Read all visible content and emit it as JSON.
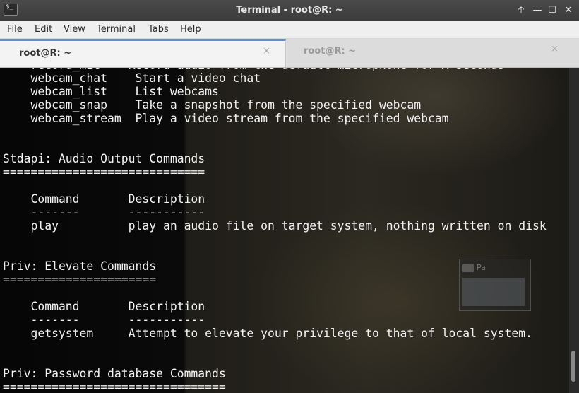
{
  "window": {
    "title": "Terminal - root@R: ~",
    "controls": {
      "up": "🡡",
      "minimize": "—",
      "maximize": "☐",
      "close": "✕"
    }
  },
  "menubar": {
    "items": [
      "File",
      "Edit",
      "View",
      "Terminal",
      "Tabs",
      "Help"
    ]
  },
  "tabs": [
    {
      "label": "root@R: ~",
      "close": "×",
      "active": true
    },
    {
      "label": "root@R: ~",
      "close": "×",
      "active": false
    }
  ],
  "terminal": {
    "text": "    record_mic    Record audio from the default microphone for X seconds\n    webcam_chat    Start a video chat\n    webcam_list    List webcams\n    webcam_snap    Take a snapshot from the specified webcam\n    webcam_stream  Play a video stream from the specified webcam\n\n\nStdapi: Audio Output Commands\n=============================\n\n    Command       Description\n    -------       -----------\n    play          play an audio file on target system, nothing written on disk\n\n\nPriv: Elevate Commands\n======================\n\n    Command       Description\n    -------       -----------\n    getsystem     Attempt to elevate your privilege to that of local system.\n\n\nPriv: Password database Commands\n================================"
  },
  "overlay": {
    "title": "Pa"
  },
  "colors": {
    "accent": "#5294e2",
    "terminal_fg": "#f2f2f2"
  }
}
